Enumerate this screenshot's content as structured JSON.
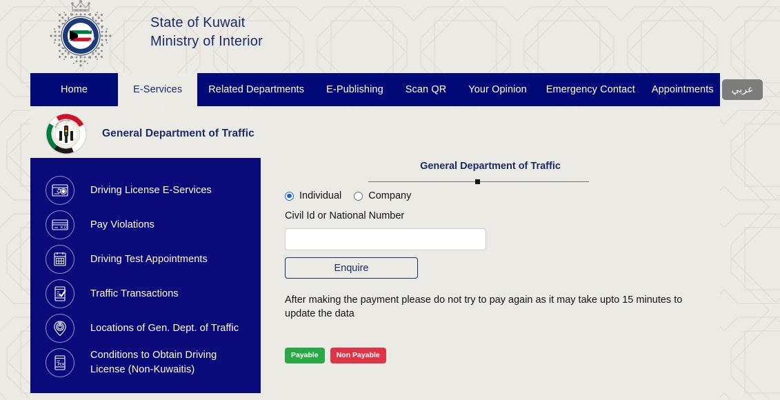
{
  "header": {
    "org_line1": "State of Kuwait",
    "org_line2": "Ministry of Interior",
    "logo_name": "kuwait-police-emblem",
    "logo_text": "KUWAIT POLICE"
  },
  "nav": {
    "items": [
      {
        "label": "Home",
        "active": false
      },
      {
        "label": "E-Services",
        "active": true
      },
      {
        "label": "Related Departments",
        "active": false
      },
      {
        "label": "E-Publishing",
        "active": false
      },
      {
        "label": "Scan QR",
        "active": false
      },
      {
        "label": "Your Opinion",
        "active": false
      },
      {
        "label": "Emergency Contact",
        "active": false
      },
      {
        "label": "Appointments",
        "active": false
      }
    ],
    "lang_button": "عربي"
  },
  "department": {
    "title": "General Department of Traffic",
    "logo_name": "general-department-of-traffic-emblem"
  },
  "sidebar": {
    "items": [
      {
        "label": "Driving License E-Services",
        "icon": "license-card-icon"
      },
      {
        "label": "Pay Violations",
        "icon": "payment-card-kd-icon"
      },
      {
        "label": "Driving Test Appointments",
        "icon": "calendar-icon"
      },
      {
        "label": " Traffic Transactions",
        "icon": "document-check-icon"
      },
      {
        "label": " Locations of Gen. Dept. of Traffic",
        "icon": "map-pin-icon"
      },
      {
        "label": "Conditions to Obtain Driving License (Non-Kuwaitis)",
        "icon": "pdf-document-icon"
      }
    ]
  },
  "main": {
    "title": "General Department of Traffic",
    "radio": {
      "individual_label": "Individual",
      "company_label": "Company",
      "selected": "Individual"
    },
    "field_label": "Civil Id or National Number",
    "input_value": "",
    "input_placeholder": "",
    "submit_label": "Enquire",
    "notice": "After making the payment please do not try to pay again as it may take upto 15 minutes to update the data",
    "legend": [
      {
        "label": "Payable",
        "color": "#28a745"
      },
      {
        "label": "Non Payable",
        "color": "#dc3545"
      }
    ]
  },
  "colors": {
    "navy": "#020a77",
    "sidebar_navy": "#0a0a7a",
    "brand_text": "#1b2a6b",
    "page_bg": "#eceae4",
    "payable_green": "#28a745",
    "non_payable_red": "#dc3545",
    "lang_button_gray": "#7d7d7d"
  }
}
